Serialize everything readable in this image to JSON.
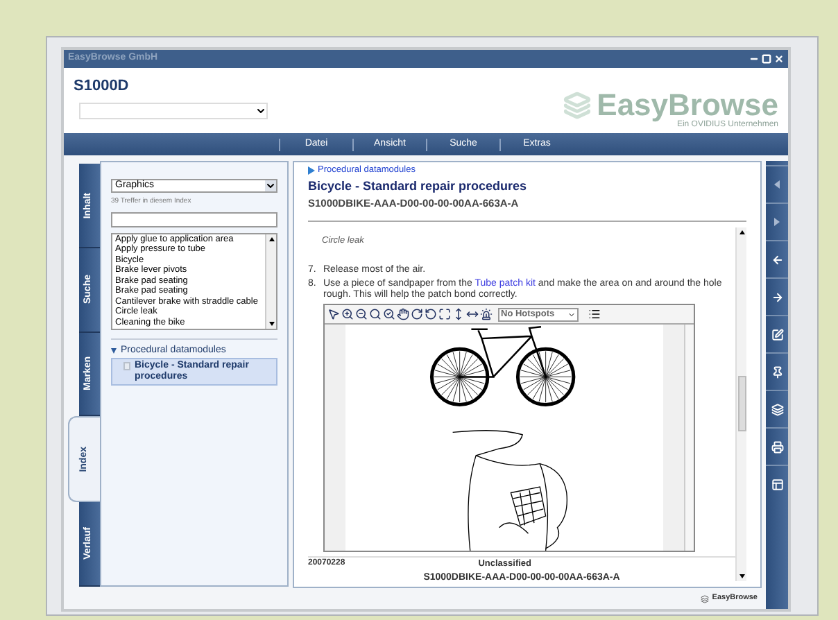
{
  "window": {
    "title": "EasyBrowse GmbH"
  },
  "header": {
    "title": "S1000D",
    "logo": "EasyBrowse",
    "logo_subtitle": "Ein OVIDIUS Unternehmen"
  },
  "menu": [
    "Datei",
    "Ansicht",
    "Suche",
    "Extras"
  ],
  "tabs": [
    {
      "label": "Inhalt",
      "selected": false
    },
    {
      "label": "Suche",
      "selected": false
    },
    {
      "label": "Marken",
      "selected": false
    },
    {
      "label": "Index",
      "selected": true
    },
    {
      "label": "Verlauf",
      "selected": false
    }
  ],
  "index_panel": {
    "category": "Graphics",
    "hits": "39 Treffer in diesem Index",
    "items": [
      "Apply glue to application area",
      "Apply pressure to tube",
      "Bicycle",
      "Brake lever pivots",
      "Brake pad seating",
      "Brake pad seating",
      "Cantilever brake with straddle cable",
      "Circle leak",
      "Cleaning the bike"
    ],
    "tree": {
      "label": "Procedural datamodules",
      "expanded": true,
      "children": [
        {
          "label": "Bicycle - Standard repair procedures",
          "selected": true
        }
      ]
    }
  },
  "document": {
    "breadcrumb": "Procedural datamodules",
    "title": "Bicycle - Standard repair procedures",
    "code": "S1000DBIKE-AAA-D00-00-00-00AA-663A-A",
    "note": "Circle leak",
    "steps": [
      {
        "number": "7.",
        "text": "Release most of the air."
      },
      {
        "number": "8.",
        "before": "Use a piece of sandpaper from the",
        "link": "Tube patch kit",
        "after": "and make the area on and around the hole rough. This will help the patch bond correctly."
      }
    ],
    "viewer": {
      "hotspots": "No Hotspots"
    },
    "footer": {
      "date": "20070228",
      "classification": "Unclassified",
      "code": "S1000DBIKE-AAA-D00-00-00-00AA-663A-A"
    }
  },
  "status_bar": {
    "brand": "EasyBrowse"
  }
}
